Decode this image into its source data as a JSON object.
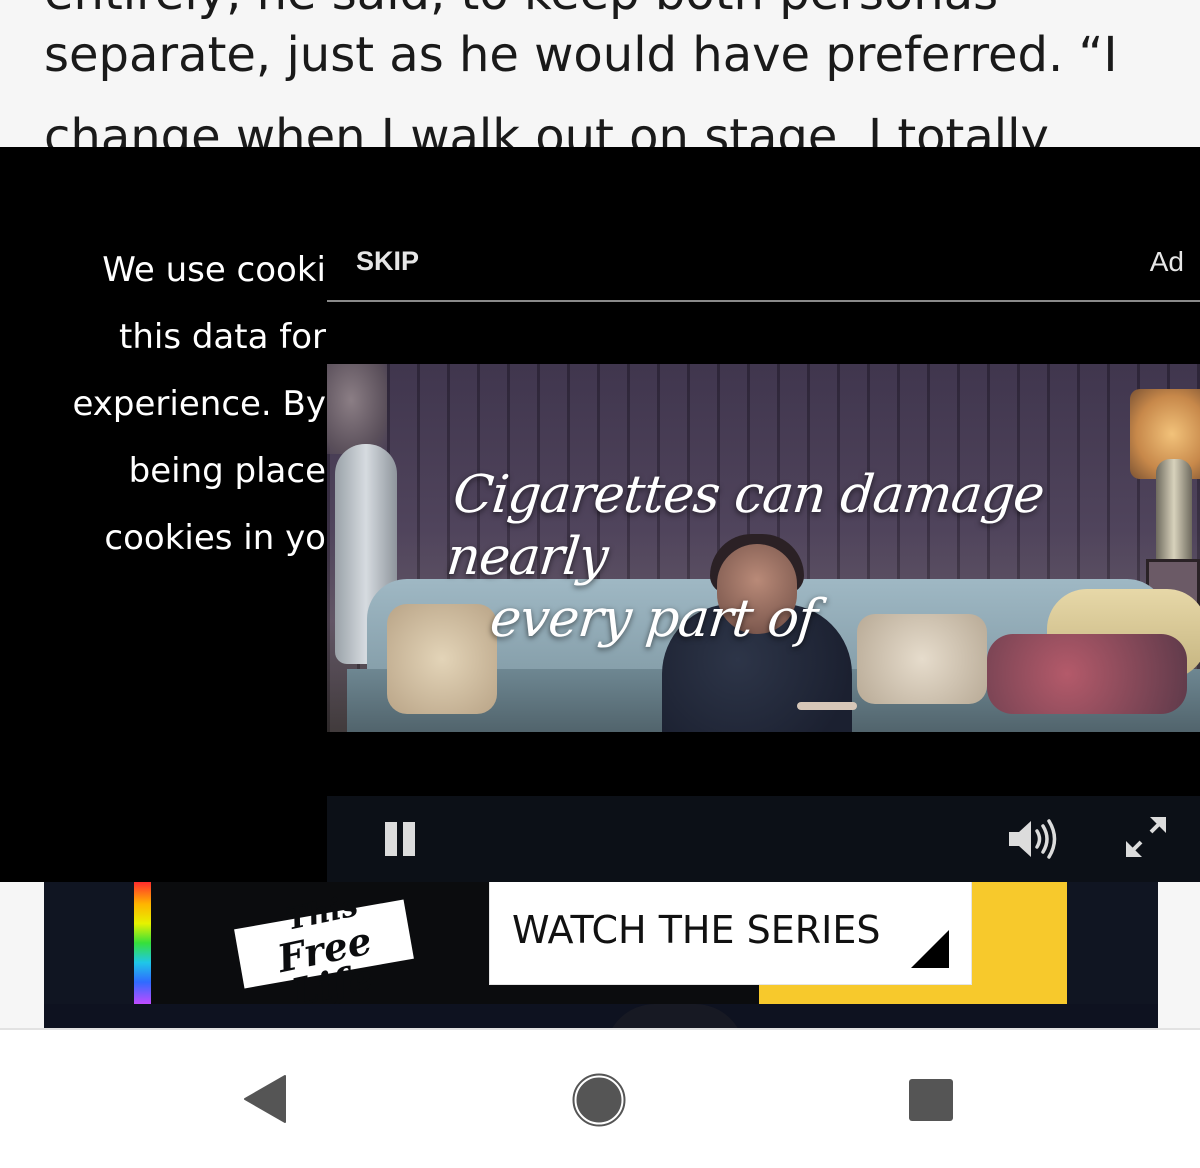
{
  "article": {
    "line_top": "entirely, he said, to keep both personas",
    "line_1": "separate, just as he would have preferred. “I",
    "line_2": "change when I walk out on stage. I totally"
  },
  "cookie_notice": {
    "lines": [
      "We use cooki",
      "this data for",
      "experience. By",
      "being place",
      "cookies in yo"
    ]
  },
  "ad_player": {
    "skip_label": "SKIP",
    "ad_label": "Ad",
    "caption_line1": "Cigarettes can damage nearly",
    "caption_line2": "every part of",
    "controls": {
      "pause_icon": "pause-icon",
      "volume_icon": "volume-icon",
      "fullscreen_icon": "fullscreen-icon"
    }
  },
  "banner": {
    "logo_line1": "This",
    "logo_line2": "Free Life",
    "cta_label": "WATCH THE SERIES",
    "accent_color": "#f7c92c"
  },
  "nav_bar": {
    "back_icon": "back-triangle-icon",
    "home_icon": "home-circle-icon",
    "recents_icon": "recents-square-icon"
  }
}
